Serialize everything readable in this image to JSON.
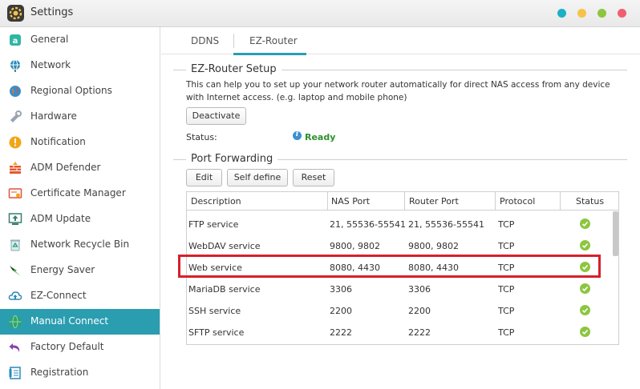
{
  "window": {
    "title": "Settings",
    "dot_colors": [
      "#1bb0c4",
      "#f6c348",
      "#8cc63f",
      "#ef5f70"
    ]
  },
  "sidebar": {
    "items": [
      {
        "label": "General",
        "icon": "general-icon",
        "color": "#2fb6a4"
      },
      {
        "label": "Network",
        "icon": "network-icon",
        "color": "#2a8ab8"
      },
      {
        "label": "Regional Options",
        "icon": "regional-options-icon",
        "color": "#e47b2d"
      },
      {
        "label": "Hardware",
        "icon": "hardware-icon",
        "color": "#9aa3b0"
      },
      {
        "label": "Notification",
        "icon": "notification-icon",
        "color": "#f2a516"
      },
      {
        "label": "ADM Defender",
        "icon": "adm-defender-icon",
        "color": "#e5562e"
      },
      {
        "label": "Certificate Manager",
        "icon": "certificate-manager-icon",
        "color": "#e0523a"
      },
      {
        "label": "ADM Update",
        "icon": "adm-update-icon",
        "color": "#3a7d6e"
      },
      {
        "label": "Network Recycle Bin",
        "icon": "recycle-bin-icon",
        "color": "#2fa36a"
      },
      {
        "label": "Energy Saver",
        "icon": "energy-saver-icon",
        "color": "#3aa43a"
      },
      {
        "label": "EZ-Connect",
        "icon": "ez-connect-icon",
        "color": "#2a8ab8"
      },
      {
        "label": "Manual Connect",
        "icon": "manual-connect-icon",
        "color": "#2fa36a",
        "active": true
      },
      {
        "label": "Factory Default",
        "icon": "factory-default-icon",
        "color": "#8a3fb0"
      },
      {
        "label": "Registration",
        "icon": "registration-icon",
        "color": "#2a8ab8"
      }
    ],
    "active_color": "#2a9db0"
  },
  "tabs": [
    {
      "label": "DDNS"
    },
    {
      "label": "EZ-Router",
      "active": true
    }
  ],
  "setup": {
    "title": "EZ-Router Setup",
    "description": "This can help you to set up your network router automatically for direct NAS access from any device with Internet access. (e.g. laptop and mobile phone)",
    "deactivate_label": "Deactivate",
    "status_label": "Status:",
    "status_value": "Ready"
  },
  "port_forwarding": {
    "title": "Port Forwarding",
    "buttons": {
      "edit": "Edit",
      "self_define": "Self define",
      "reset": "Reset"
    },
    "columns": [
      "Description",
      "NAS Port",
      "Router Port",
      "Protocol",
      "Status"
    ],
    "rows": [
      {
        "description": "FTP service",
        "nas_port": "21, 55536-55541",
        "router_port": "21, 55536-55541",
        "protocol": "TCP",
        "status": "enabled"
      },
      {
        "description": "WebDAV service",
        "nas_port": "9800, 9802",
        "router_port": "9800, 9802",
        "protocol": "TCP",
        "status": "enabled"
      },
      {
        "description": "Web service",
        "nas_port": "8080, 4430",
        "router_port": "8080, 4430",
        "protocol": "TCP",
        "status": "enabled"
      },
      {
        "description": "MariaDB service",
        "nas_port": "3306",
        "router_port": "3306",
        "protocol": "TCP",
        "status": "enabled"
      },
      {
        "description": "SSH service",
        "nas_port": "2200",
        "router_port": "2200",
        "protocol": "TCP",
        "status": "enabled"
      },
      {
        "description": "SFTP service",
        "nas_port": "2222",
        "router_port": "2222",
        "protocol": "TCP",
        "status": "enabled"
      }
    ],
    "highlight_color": "#d6202a",
    "status_color": "#8cc63f"
  }
}
